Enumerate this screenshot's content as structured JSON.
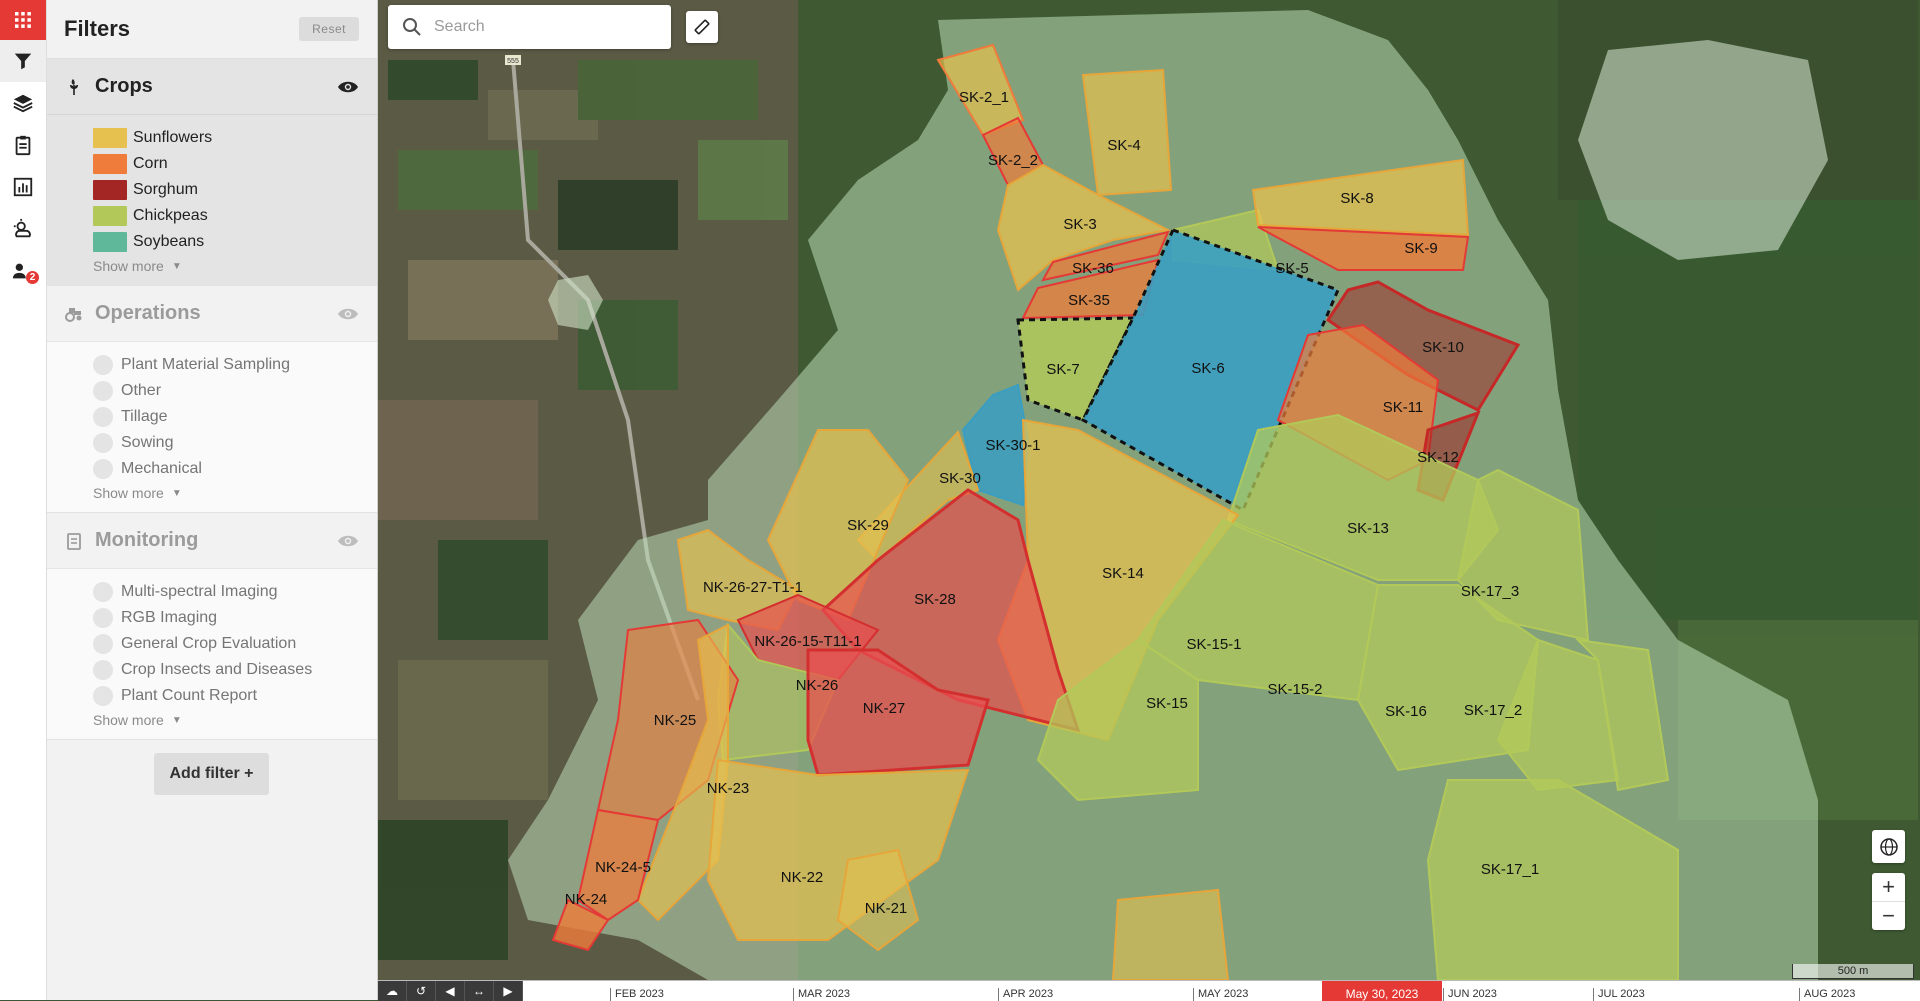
{
  "filters": {
    "title": "Filters",
    "reset_label": "Reset"
  },
  "sections": {
    "crops": {
      "title": "Crops",
      "items": [
        {
          "label": "Sunflowers",
          "color": "#e6c14f"
        },
        {
          "label": "Corn",
          "color": "#ef7c3a"
        },
        {
          "label": "Sorghum",
          "color": "#a32624"
        },
        {
          "label": "Chickpeas",
          "color": "#b2c95a"
        },
        {
          "label": "Soybeans",
          "color": "#5fb89a"
        }
      ],
      "show_more": "Show more"
    },
    "operations": {
      "title": "Operations",
      "items": [
        "Plant Material Sampling",
        "Other",
        "Tillage",
        "Sowing",
        "Mechanical"
      ],
      "show_more": "Show more"
    },
    "monitoring": {
      "title": "Monitoring",
      "items": [
        "Multi-spectral Imaging",
        "RGB Imaging",
        "General Crop Evaluation",
        "Crop Insects and Diseases",
        "Plant Count Report"
      ],
      "show_more": "Show more"
    },
    "add_filter": "Add filter +"
  },
  "rail": {
    "notification_count": "2"
  },
  "search": {
    "placeholder": "Search",
    "value": ""
  },
  "road_sign": "555",
  "fields": [
    {
      "label": "SK-2_1"
    },
    {
      "label": "SK-2_2"
    },
    {
      "label": "SK-4"
    },
    {
      "label": "SK-3"
    },
    {
      "label": "SK-36"
    },
    {
      "label": "SK-35"
    },
    {
      "label": "SK-5"
    },
    {
      "label": "SK-8"
    },
    {
      "label": "SK-9"
    },
    {
      "label": "SK-7"
    },
    {
      "label": "SK-6"
    },
    {
      "label": "SK-10"
    },
    {
      "label": "SK-11"
    },
    {
      "label": "SK-12"
    },
    {
      "label": "SK-30-1"
    },
    {
      "label": "SK-30"
    },
    {
      "label": "SK-29"
    },
    {
      "label": "SK-13"
    },
    {
      "label": "SK-14"
    },
    {
      "label": "SK-28"
    },
    {
      "label": "SK-17_3"
    },
    {
      "label": "NK-26-27-T1-1"
    },
    {
      "label": "NK-26-15-T11-1"
    },
    {
      "label": "SK-15-1"
    },
    {
      "label": "NK-26"
    },
    {
      "label": "SK-15-2"
    },
    {
      "label": "NK-27"
    },
    {
      "label": "SK-15"
    },
    {
      "label": "SK-16"
    },
    {
      "label": "SK-17_2"
    },
    {
      "label": "NK-25"
    },
    {
      "label": "NK-23"
    },
    {
      "label": "NK-22"
    },
    {
      "label": "NK-24-5"
    },
    {
      "label": "NK-24"
    },
    {
      "label": "NK-21"
    },
    {
      "label": "SK-17_1"
    }
  ],
  "scale_label": "500 m",
  "timeline": {
    "months": [
      "FEB 2023",
      "MAR 2023",
      "APR 2023",
      "MAY 2023",
      "JUN 2023",
      "JUL 2023",
      "AUG 2023"
    ],
    "selected_date": "May 30, 2023"
  }
}
